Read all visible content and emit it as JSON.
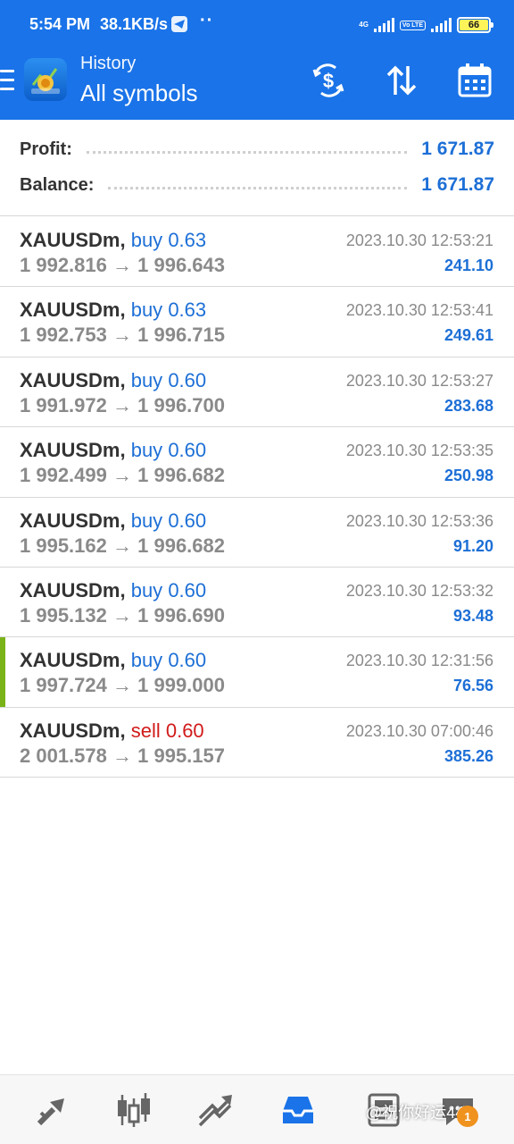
{
  "status_bar": {
    "time": "5:54 PM",
    "speed": "38.1KB/s",
    "dots": "··",
    "network_1": "4G",
    "network_2": "Vo LTE",
    "battery": "66"
  },
  "app_bar": {
    "title": "History",
    "subtitle": "All symbols"
  },
  "summary": {
    "profit_label": "Profit:",
    "profit_value": "1 671.87",
    "balance_label": "Balance:",
    "balance_value": "1 671.87"
  },
  "trades": [
    {
      "symbol": "XAUUSDm,",
      "side": "buy",
      "volume": "0.63",
      "open_price": "1 992.816",
      "arrow": "→",
      "close_price": "1 996.643",
      "time": "2023.10.30 12:53:21",
      "profit": "241.10"
    },
    {
      "symbol": "XAUUSDm,",
      "side": "buy",
      "volume": "0.63",
      "open_price": "1 992.753",
      "arrow": "→",
      "close_price": "1 996.715",
      "time": "2023.10.30 12:53:41",
      "profit": "249.61"
    },
    {
      "symbol": "XAUUSDm,",
      "side": "buy",
      "volume": "0.60",
      "open_price": "1 991.972",
      "arrow": "→",
      "close_price": "1 996.700",
      "time": "2023.10.30 12:53:27",
      "profit": "283.68"
    },
    {
      "symbol": "XAUUSDm,",
      "side": "buy",
      "volume": "0.60",
      "open_price": "1 992.499",
      "arrow": "→",
      "close_price": "1 996.682",
      "time": "2023.10.30 12:53:35",
      "profit": "250.98"
    },
    {
      "symbol": "XAUUSDm,",
      "side": "buy",
      "volume": "0.60",
      "open_price": "1 995.162",
      "arrow": "→",
      "close_price": "1 996.682",
      "time": "2023.10.30 12:53:36",
      "profit": "91.20"
    },
    {
      "symbol": "XAUUSDm,",
      "side": "buy",
      "volume": "0.60",
      "open_price": "1 995.132",
      "arrow": "→",
      "close_price": "1 996.690",
      "time": "2023.10.30 12:53:32",
      "profit": "93.48"
    },
    {
      "symbol": "XAUUSDm,",
      "side": "buy",
      "volume": "0.60",
      "open_price": "1 997.724",
      "arrow": "→",
      "close_price": "1 999.000",
      "time": "2023.10.30 12:31:56",
      "profit": "76.56"
    },
    {
      "symbol": "XAUUSDm,",
      "side": "sell",
      "volume": "0.60",
      "open_price": "2 001.578",
      "arrow": "→",
      "close_price": "1 995.157",
      "time": "2023.10.30 07:00:46",
      "profit": "385.26"
    }
  ],
  "bottom_nav": {
    "items": [
      "quotes-icon",
      "chart-icon",
      "trade-icon",
      "history-icon",
      "news-icon",
      "chat-icon"
    ],
    "active": "history-icon",
    "watermark": "@祝你好运444",
    "chat_badge": "1"
  },
  "colors": {
    "accent": "#1a73e8",
    "buy": "#1d6fd6",
    "sell": "#d11a1a",
    "highlight_bar": "#7ab317"
  }
}
